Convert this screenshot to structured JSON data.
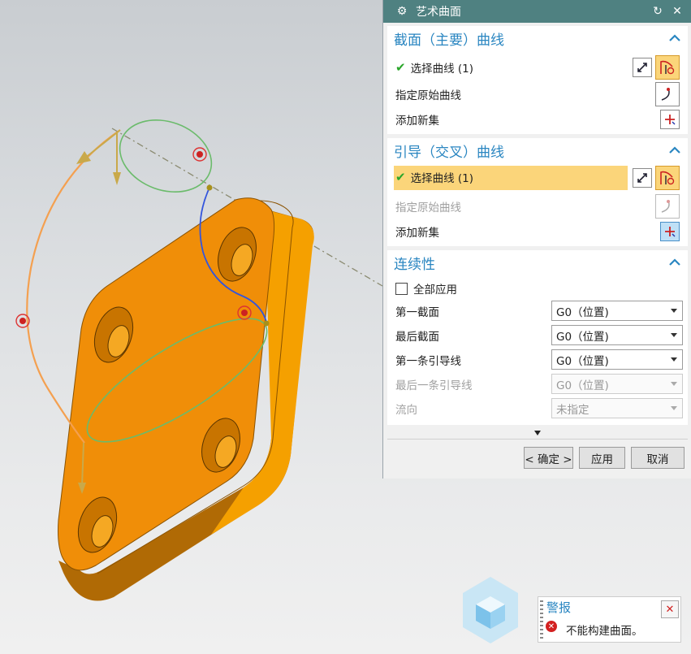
{
  "dialog": {
    "title": "艺术曲面",
    "section1": {
      "heading": "截面（主要）曲线",
      "select_curve": "选择曲线 (1)",
      "specify_origin": "指定原始曲线",
      "add_new_set": "添加新集"
    },
    "section2": {
      "heading": "引导（交叉）曲线",
      "select_curve": "选择曲线 (1)",
      "specify_origin": "指定原始曲线",
      "add_new_set": "添加新集"
    },
    "section3": {
      "heading": "连续性",
      "apply_all": "全部应用",
      "rows": [
        {
          "label": "第一截面",
          "value": "G0（位置)"
        },
        {
          "label": "最后截面",
          "value": "G0（位置)"
        },
        {
          "label": "第一条引导线",
          "value": "G0（位置)"
        },
        {
          "label": "最后一条引导线",
          "value": "G0（位置)"
        },
        {
          "label": "流向",
          "value": "未指定"
        }
      ]
    },
    "buttons": {
      "ok": "< 确定 >",
      "apply": "应用",
      "cancel": "取消"
    }
  },
  "alert": {
    "title": "警报",
    "message": "不能构建曲面。"
  },
  "colors": {
    "title_bar": "#4f8181",
    "section_heading": "#2a86c1",
    "highlight": "#fbd57a",
    "part_orange": "#f0960a"
  }
}
